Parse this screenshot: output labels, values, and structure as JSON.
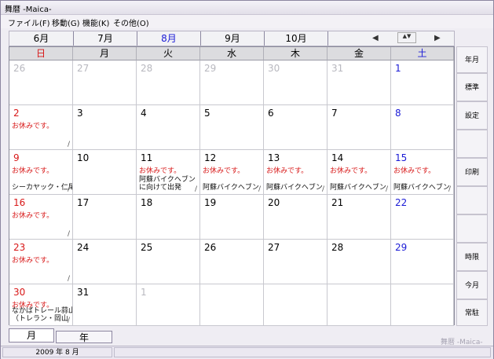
{
  "window": {
    "title": "舞暦 -Maica-"
  },
  "menu": [
    "ファイル(F)",
    "移動(G)",
    "機能(K)",
    "その他(O)"
  ],
  "months": [
    "6月",
    "7月",
    "8月",
    "9月",
    "10月"
  ],
  "current_month_index": 2,
  "nav": {
    "prev": "◀",
    "spin": "▲▼",
    "next": "▶"
  },
  "weekdays": [
    "日",
    "月",
    "火",
    "水",
    "木",
    "金",
    "土"
  ],
  "colors": {
    "sunday": "#d81818",
    "saturday": "#1b1bd6",
    "weekday": "#000000",
    "other_month": "#b8b8bf",
    "current_month_tab": "#1b1bd6"
  },
  "weeks": [
    [
      {
        "d": "26",
        "other": true
      },
      {
        "d": "27",
        "other": true
      },
      {
        "d": "28",
        "other": true
      },
      {
        "d": "29",
        "other": true
      },
      {
        "d": "30",
        "other": true
      },
      {
        "d": "31",
        "other": true
      },
      {
        "d": "1"
      }
    ],
    [
      {
        "d": "2",
        "note": "お休みです。",
        "slash": true
      },
      {
        "d": "3"
      },
      {
        "d": "4"
      },
      {
        "d": "5"
      },
      {
        "d": "6"
      },
      {
        "d": "7"
      },
      {
        "d": "8"
      }
    ],
    [
      {
        "d": "9",
        "note": "お休みです。",
        "ev": "シーカヤック・仁尾",
        "slash": true
      },
      {
        "d": "10"
      },
      {
        "d": "11",
        "note": "お休みです。",
        "ev": "阿蘇バイクヘブン\nに向けて出発",
        "slash": true
      },
      {
        "d": "12",
        "note": "お休みです。",
        "ev": "阿蘇バイクヘブン",
        "slash": true
      },
      {
        "d": "13",
        "note": "お休みです。",
        "ev": "阿蘇バイクヘブン",
        "slash": true
      },
      {
        "d": "14",
        "note": "お休みです。",
        "ev": "阿蘇バイクヘブン",
        "slash": true
      },
      {
        "d": "15",
        "note": "お休みです。",
        "ev": "阿蘇バイクヘブン",
        "slash": true
      }
    ],
    [
      {
        "d": "16",
        "note": "お休みです。",
        "slash": true
      },
      {
        "d": "17"
      },
      {
        "d": "18"
      },
      {
        "d": "19"
      },
      {
        "d": "20"
      },
      {
        "d": "21"
      },
      {
        "d": "22"
      }
    ],
    [
      {
        "d": "23",
        "note": "お休みです。",
        "slash": true
      },
      {
        "d": "24"
      },
      {
        "d": "25"
      },
      {
        "d": "26"
      },
      {
        "d": "27"
      },
      {
        "d": "28"
      },
      {
        "d": "29"
      }
    ],
    [
      {
        "d": "30",
        "note": "お休みです。",
        "ev": "なかばトレール蒜山\n（トレラン・岡山",
        "slash": true
      },
      {
        "d": "31"
      },
      {
        "d": "1",
        "other": true
      },
      {
        "d": ""
      },
      {
        "d": ""
      },
      {
        "d": ""
      },
      {
        "d": ""
      }
    ]
  ],
  "side_buttons": [
    "年月",
    "標準",
    "設定",
    "",
    "印刷",
    "",
    "",
    "時限",
    "今月",
    "常駐"
  ],
  "tabs": {
    "month": "月",
    "year": "年"
  },
  "brand": "舞暦 -Maica-",
  "status": {
    "date": "2009 年 8 月"
  }
}
